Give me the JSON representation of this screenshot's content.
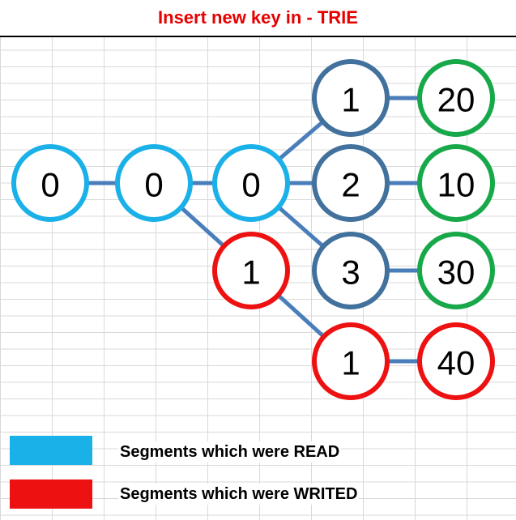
{
  "title": "Insert new key in - TRIE",
  "colors": {
    "title": "#e60000",
    "read": "#1ab0e8",
    "write": "#ee1111",
    "existing": "#41719c",
    "value": "#17a84a",
    "edge": "#4a7ebb"
  },
  "nodes": [
    {
      "id": "root",
      "label": "0",
      "role": "read"
    },
    {
      "id": "n2",
      "label": "0",
      "role": "read"
    },
    {
      "id": "n3",
      "label": "0",
      "role": "read"
    },
    {
      "id": "n4a",
      "label": "1",
      "role": "existing"
    },
    {
      "id": "n4b",
      "label": "2",
      "role": "existing"
    },
    {
      "id": "n4c",
      "label": "3",
      "role": "existing"
    },
    {
      "id": "v20",
      "label": "20",
      "role": "value"
    },
    {
      "id": "v10",
      "label": "10",
      "role": "value"
    },
    {
      "id": "v30",
      "label": "30",
      "role": "value"
    },
    {
      "id": "w3",
      "label": "1",
      "role": "write"
    },
    {
      "id": "w4",
      "label": "1",
      "role": "write"
    },
    {
      "id": "w40",
      "label": "40",
      "role": "write"
    }
  ],
  "edges": [
    [
      "root",
      "n2"
    ],
    [
      "n2",
      "n3"
    ],
    [
      "n3",
      "n4a"
    ],
    [
      "n3",
      "n4b"
    ],
    [
      "n3",
      "n4c"
    ],
    [
      "n4a",
      "v20"
    ],
    [
      "n4b",
      "v10"
    ],
    [
      "n4c",
      "v30"
    ],
    [
      "n2",
      "w3"
    ],
    [
      "w3",
      "w4"
    ],
    [
      "w4",
      "w40"
    ]
  ],
  "legend": [
    {
      "label": "Segments which were READ",
      "color": "#1ab0e8"
    },
    {
      "label": "Segments which were WRITED",
      "color": "#ee1111"
    }
  ]
}
